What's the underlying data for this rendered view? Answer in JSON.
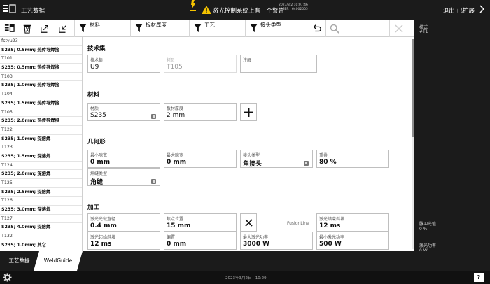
{
  "titlebar": {
    "app_title": "工艺数据",
    "alert_text": "激光控制系统上有一个警告",
    "alert_meta_line1": "2023/3/2 10:07:46",
    "alert_meta_line2": "LASER : 64002005",
    "exit_label": "退出 已扩展"
  },
  "toolbar": {
    "filters": [
      {
        "label": "材料"
      },
      {
        "label": "板材厚度"
      },
      {
        "label": "工艺"
      },
      {
        "label": "接头类型"
      }
    ]
  },
  "right_panel": {
    "mode_label": "模式",
    "mode_value": "#T1",
    "laser_light_label": "脉冲光值",
    "laser_light_value": "0 %",
    "laser_power_label": "激光功率",
    "laser_power_value": "0 W"
  },
  "list": {
    "items": [
      {
        "code": "fstyu23",
        "desc": "S235; 0.5mm; 热传导焊接"
      },
      {
        "code": "T101",
        "desc": "S235; 0.5mm; 热传导焊接"
      },
      {
        "code": "T103",
        "desc": "S235; 1.0mm; 热传导焊接"
      },
      {
        "code": "T104",
        "desc": "S235; 1.5mm; 热传导焊接"
      },
      {
        "code": "T105",
        "desc": "S235; 2.0mm; 热传导焊接"
      },
      {
        "code": "T122",
        "desc": "S235; 1.0mm; 深熔焊"
      },
      {
        "code": "T123",
        "desc": "S235; 1.5mm; 深熔焊"
      },
      {
        "code": "T124",
        "desc": "S235; 2.0mm; 深熔焊"
      },
      {
        "code": "T125",
        "desc": "S235; 2.5mm; 深熔焊"
      },
      {
        "code": "T126",
        "desc": "S235; 3.0mm; 深熔焊"
      },
      {
        "code": "T127",
        "desc": "S235; 4.0mm; 深熔焊"
      },
      {
        "code": "T132",
        "desc": "S235; 1.0mm; 其它"
      },
      {
        "code": "T133",
        "desc": ""
      }
    ]
  },
  "sections": {
    "techset": {
      "title": "技术集",
      "techset_label": "技术集",
      "techset_value": "U9",
      "copy_label": "拷贝",
      "copy_value": "T105",
      "note_label": "注解",
      "note_value": ""
    },
    "material": {
      "title": "材料",
      "material_label": "材质",
      "material_value": "S235",
      "thickness_label": "板材厚度",
      "thickness_value": "2 mm"
    },
    "geometry": {
      "title": "几何形",
      "min_gap_label": "最小隙宽",
      "min_gap_value": "0 mm",
      "max_gap_label": "最大隙宽",
      "max_gap_value": "0 mm",
      "joint_label": "接头类型",
      "joint_value": "角接头",
      "overlap_label": "重叠",
      "overlap_value": "80 %",
      "seam_label": "焊缝类型",
      "seam_value": "角缝"
    },
    "process": {
      "title": "加工",
      "spot_label": "激光光斑直径",
      "spot_value": "0.4 mm",
      "focus_label": "焦点位置",
      "focus_value": "15 mm",
      "fusionline_label": "FusionLine",
      "ramp_end_label": "激光结束斜坡",
      "ramp_end_value": "12 ms",
      "ramp_start_label": "激光起始斜坡",
      "ramp_start_value": "12 ms",
      "offset_label": "偏置",
      "offset_value": "0 mm",
      "max_power_label": "最大激光功率",
      "max_power_value": "3000 W",
      "min_power_label": "最小激光功率",
      "min_power_value": "500 W"
    }
  },
  "tabs": [
    {
      "label": "工艺数据"
    },
    {
      "label": "WeldGuide"
    }
  ],
  "statusbar": {
    "datetime": "2023年3月2日 · 10:29",
    "help_label": "?"
  },
  "colors": {
    "dark_bg": "#1b1b1b",
    "alert_yellow": "#f6c400",
    "panel_white": "#ffffff"
  }
}
